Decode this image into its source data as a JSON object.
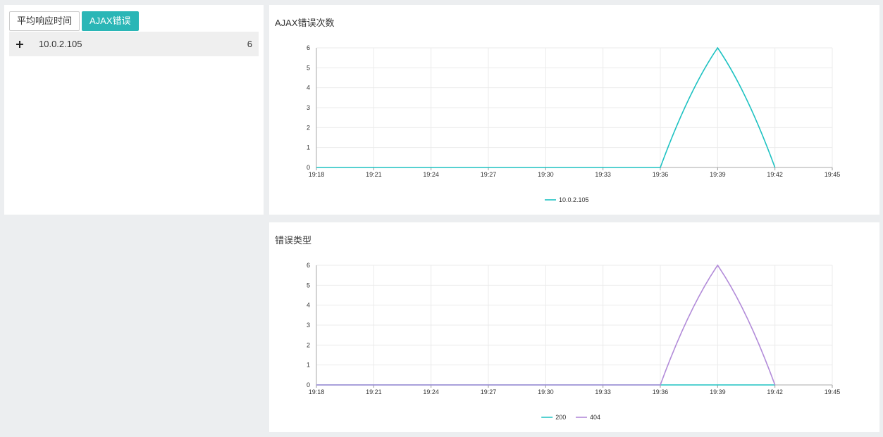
{
  "tabs": [
    {
      "label": "平均响应时间",
      "active": false
    },
    {
      "label": "AJAX错误",
      "active": true
    }
  ],
  "ip_list": [
    {
      "ip": "10.0.2.105",
      "count": "6"
    }
  ],
  "charts": [
    {
      "title": "AJAX错误次数",
      "chart_data": {
        "type": "line",
        "x": [
          "19:18",
          "19:21",
          "19:24",
          "19:27",
          "19:30",
          "19:33",
          "19:36",
          "19:39",
          "19:42",
          "19:45"
        ],
        "ylim": [
          0,
          6
        ],
        "yticks": [
          0,
          1,
          2,
          3,
          4,
          5,
          6
        ],
        "grid": true,
        "legend_position": "bottom",
        "series": [
          {
            "name": "10.0.2.105",
            "color": "#1ec2c2",
            "values": [
              0,
              0,
              0,
              0,
              0,
              0,
              0,
              6,
              0,
              null
            ]
          }
        ]
      }
    },
    {
      "title": "错误类型",
      "chart_data": {
        "type": "line",
        "x": [
          "19:18",
          "19:21",
          "19:24",
          "19:27",
          "19:30",
          "19:33",
          "19:36",
          "19:39",
          "19:42",
          "19:45"
        ],
        "ylim": [
          0,
          6
        ],
        "yticks": [
          0,
          1,
          2,
          3,
          4,
          5,
          6
        ],
        "grid": true,
        "legend_position": "bottom",
        "series": [
          {
            "name": "200",
            "color": "#1ec2c2",
            "values": [
              0,
              0,
              0,
              0,
              0,
              0,
              0,
              0,
              0,
              null
            ]
          },
          {
            "name": "404",
            "color": "#b28bd9",
            "values": [
              0,
              0,
              0,
              0,
              0,
              0,
              0,
              6,
              0,
              null
            ]
          }
        ]
      }
    }
  ]
}
